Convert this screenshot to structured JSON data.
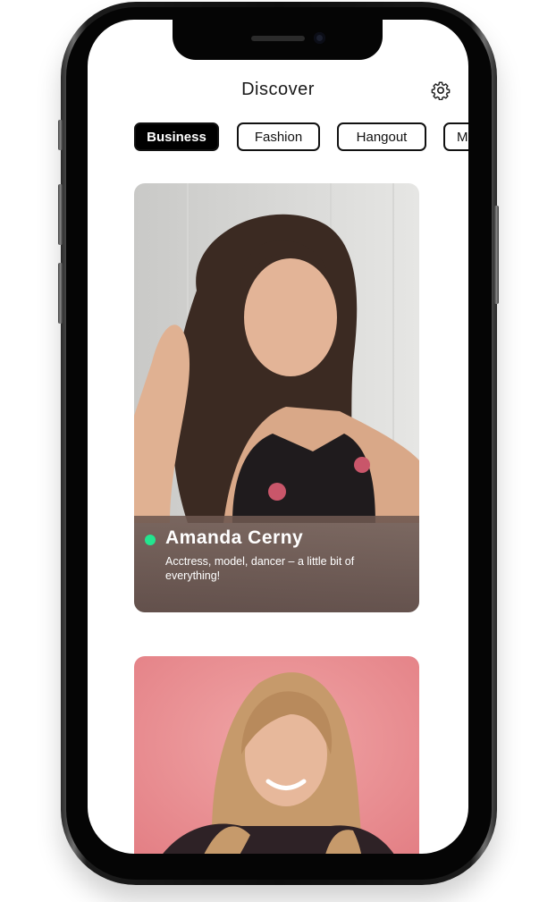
{
  "header": {
    "title": "Discover",
    "settings_icon": "gear-icon"
  },
  "categories": [
    {
      "label": "Business",
      "active": true
    },
    {
      "label": "Fashion",
      "active": false
    },
    {
      "label": "Hangout",
      "active": false
    },
    {
      "label": "M",
      "active": false
    }
  ],
  "profiles": [
    {
      "name": "Amanda Cerny",
      "bio": "Acctress, model, dancer – a little bit of everything!",
      "online": true,
      "status_color": "#23e58f"
    },
    {
      "name": "",
      "bio": "",
      "photo_bg": "#e98a8f"
    }
  ],
  "colors": {
    "accent": "#000000",
    "online": "#23e58f",
    "background": "#ffffff"
  }
}
